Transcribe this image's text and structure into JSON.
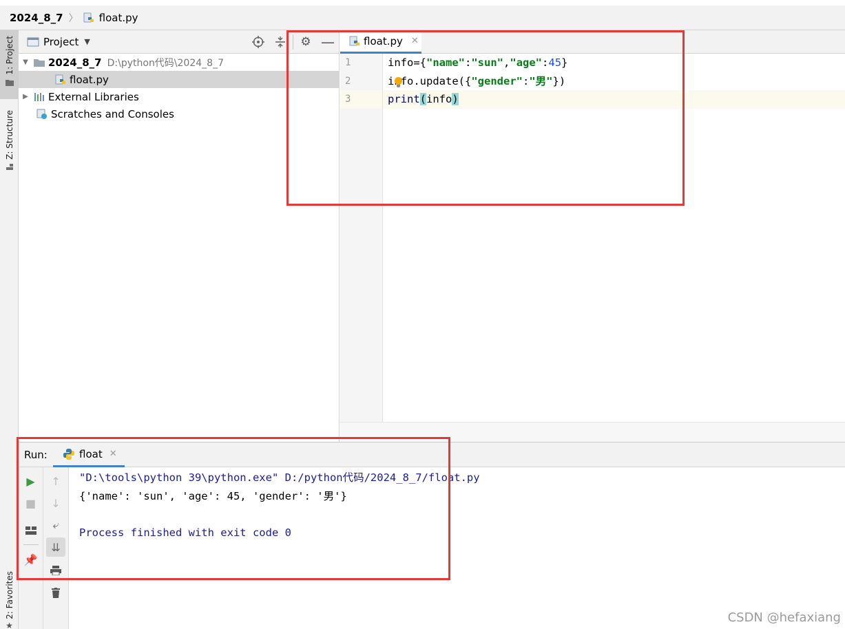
{
  "breadcrumb": {
    "root": "2024_8_7",
    "file": "float.py"
  },
  "left_strip": {
    "project_tab": "1: Project",
    "structure_tab": "Z: Structure",
    "favorites_tab": "2: Favorites"
  },
  "project_panel": {
    "title": "Project",
    "tree": {
      "root_name": "2024_8_7",
      "root_path": "D:\\python代码\\2024_8_7",
      "file": "float.py",
      "external_libraries": "External Libraries",
      "scratches": "Scratches and Consoles"
    }
  },
  "editor": {
    "tab_label": "float.py",
    "line_numbers": [
      "1",
      "2",
      "3"
    ],
    "code": {
      "l1_a": "info={",
      "l1_k1": "\"name\"",
      "l1_c1": ":",
      "l1_v1": "\"sun\"",
      "l1_comma": ",",
      "l1_k2": "\"age\"",
      "l1_c2": ":",
      "l1_v2": "45",
      "l1_end": "}",
      "l2_a": "info.update({",
      "l2_k": "\"gender\"",
      "l2_c": ":",
      "l2_v": "\"男\"",
      "l2_end": "})",
      "l3_fn": "print",
      "l3_open": "(",
      "l3_arg": "info",
      "l3_close": ")"
    }
  },
  "run_panel": {
    "label": "Run:",
    "tab_label": "float",
    "output": {
      "command": "\"D:\\tools\\python 39\\python.exe\" D:/python代码/2024_8_7/float.py",
      "result": "{'name': 'sun', 'age': 45, 'gender': '男'}",
      "exit": "Process finished with exit code 0"
    }
  },
  "watermark": "CSDN @hefaxiang",
  "colors": {
    "accent": "#4083c9",
    "annotation_red": "#e53935",
    "string_green": "#067d17",
    "number_blue": "#1750eb"
  }
}
